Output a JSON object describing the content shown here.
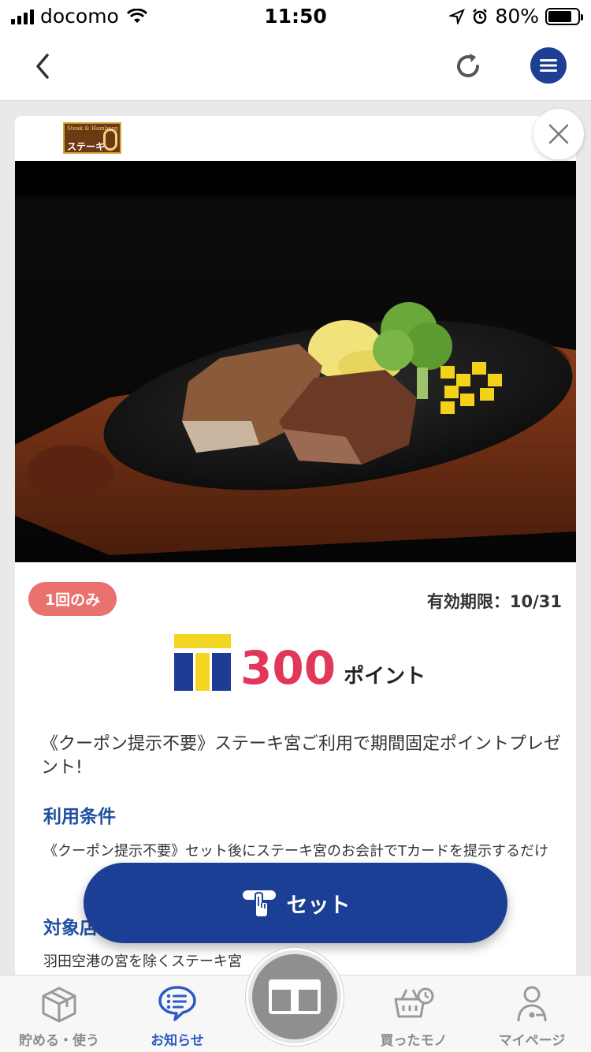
{
  "status_bar": {
    "carrier": "docomo",
    "time": "11:50",
    "battery": "80%",
    "battery_level": 0.8
  },
  "nav": {
    "back_icon": "chevron-left-icon",
    "reload_icon": "reload-icon",
    "menu_icon": "menu-icon"
  },
  "coupon": {
    "brand_logo_text": "ステーキ",
    "brand_logo_sub": "Steak & Hamburg",
    "tag": "1回のみ",
    "expiry": "有効期限：10/31",
    "points_value": "300",
    "points_unit": "ポイント",
    "description": "《クーポン提示不要》ステーキ宮ご利用で期間固定ポイントプレゼント!",
    "conditions_title": "利用条件",
    "conditions_text": "《クーポン提示不要》セット後にステーキ宮のお会計でTカードを提示するだけ",
    "target_title": "対象店",
    "target_text": "羽田空港の宮を除くステーキ宮"
  },
  "set_button": {
    "label": "セット"
  },
  "tabs": [
    {
      "label": "貯める・使う",
      "icon": "box-icon",
      "active": false
    },
    {
      "label": "お知らせ",
      "icon": "chat-icon",
      "active": true
    },
    {
      "label": "買ったモノ",
      "icon": "basket-icon",
      "active": false
    },
    {
      "label": "マイページ",
      "icon": "person-icon",
      "active": false
    }
  ],
  "colors": {
    "brand_blue": "#1b3f94",
    "points_red": "#e0375a",
    "tag_pink": "#e9716e",
    "tab_active": "#2e5bc3"
  }
}
